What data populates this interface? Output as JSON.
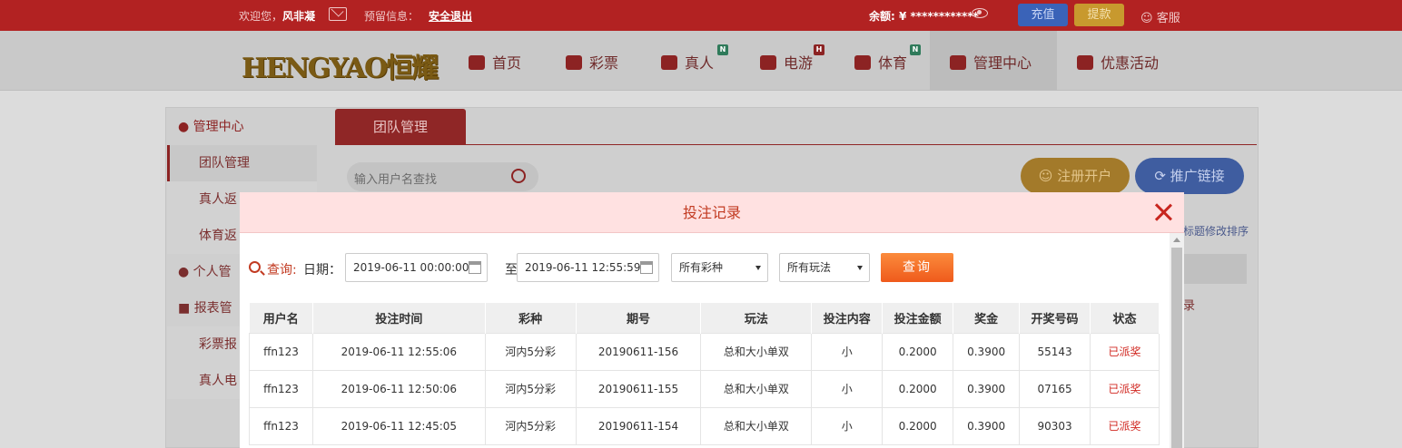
{
  "topbar": {
    "welcome_prefix": "欢迎您，",
    "username": "风非凝",
    "notice": "预留信息：",
    "logout": "安全退出",
    "balance": "余额: ¥ ************",
    "charge": "充值",
    "withdraw": "提款",
    "service": "客服"
  },
  "nav": {
    "logo": "HENGYAO恒耀",
    "items": [
      {
        "label": "首页"
      },
      {
        "label": "彩票"
      },
      {
        "label": "真人",
        "badge": "N"
      },
      {
        "label": "电游",
        "badge": "H"
      },
      {
        "label": "体育",
        "badge": "N"
      },
      {
        "label": "管理中心"
      },
      {
        "label": "优惠活动"
      }
    ]
  },
  "sidebar": {
    "head": "管理中心",
    "items": [
      "团队管理",
      "真人返",
      "体育返"
    ],
    "group_personal": "个人管",
    "group_report": "报表管",
    "report_items": [
      "彩票报",
      "真人电"
    ]
  },
  "background": {
    "tab": "团队管理",
    "search_placeholder": "输入用户名查找",
    "register_btn": "注册开户",
    "promo_btn": "推广链接",
    "sort_hint": "标题修改排序",
    "record_link": "录"
  },
  "modal": {
    "title": "投注记录",
    "query_label": "查询:",
    "date_label": "日期：",
    "date_from": "2019-06-11 00:00:00",
    "to": "至",
    "date_to": "2019-06-11 12:55:59",
    "lottery_select": "所有彩种",
    "play_select": "所有玩法",
    "query_btn": "查询",
    "columns": [
      "用户名",
      "投注时间",
      "彩种",
      "期号",
      "玩法",
      "投注内容",
      "投注金额",
      "奖金",
      "开奖号码",
      "状态"
    ],
    "rows": [
      [
        "ffn123",
        "2019-06-11 12:55:06",
        "河内5分彩",
        "20190611-156",
        "总和大小单双",
        "小",
        "0.2000",
        "0.3900",
        "55143",
        "已派奖"
      ],
      [
        "ffn123",
        "2019-06-11 12:50:06",
        "河内5分彩",
        "20190611-155",
        "总和大小单双",
        "小",
        "0.2000",
        "0.3900",
        "07165",
        "已派奖"
      ],
      [
        "ffn123",
        "2019-06-11 12:45:05",
        "河内5分彩",
        "20190611-154",
        "总和大小单双",
        "小",
        "0.2000",
        "0.3900",
        "90303",
        "已派奖"
      ]
    ]
  },
  "colors": {
    "brand_red": "#b22222",
    "accent_orange": "#ef5a1c",
    "status_red": "#d0261f"
  }
}
